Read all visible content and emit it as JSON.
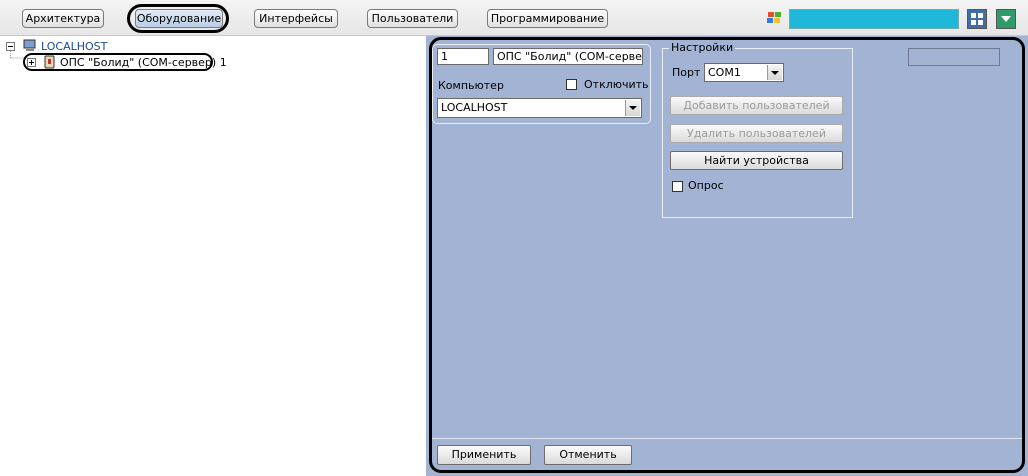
{
  "toolbar": {
    "tabs": [
      {
        "label": "Архитектура"
      },
      {
        "label": "Оборудование"
      },
      {
        "label": "Интерфейсы"
      },
      {
        "label": "Пользователи"
      },
      {
        "label": "Программирование"
      }
    ],
    "search_color": "#20b8d8"
  },
  "tree": {
    "root": {
      "label": "LOCALHOST",
      "icon": "computer-icon"
    },
    "child": {
      "label": "ОПС \"Болид\" (COM-сервер) 1",
      "icon": "device-icon"
    }
  },
  "panel": {
    "number_value": "1",
    "name_value": "ОПС \"Болид\" (COM-сервер)",
    "computer_label": "Компьютер",
    "disable_label": "Отключить",
    "computer_value": "LOCALHOST",
    "settings": {
      "title": "Настройки",
      "port_label": "Порт",
      "port_value": "COM1",
      "add_users": "Добавить пользователей",
      "remove_users": "Удалить пользователей",
      "find_devices": "Найти устройства",
      "poll_label": "Опрос"
    },
    "apply": "Применить",
    "cancel": "Отменить",
    "background": "#a3b3d4"
  }
}
